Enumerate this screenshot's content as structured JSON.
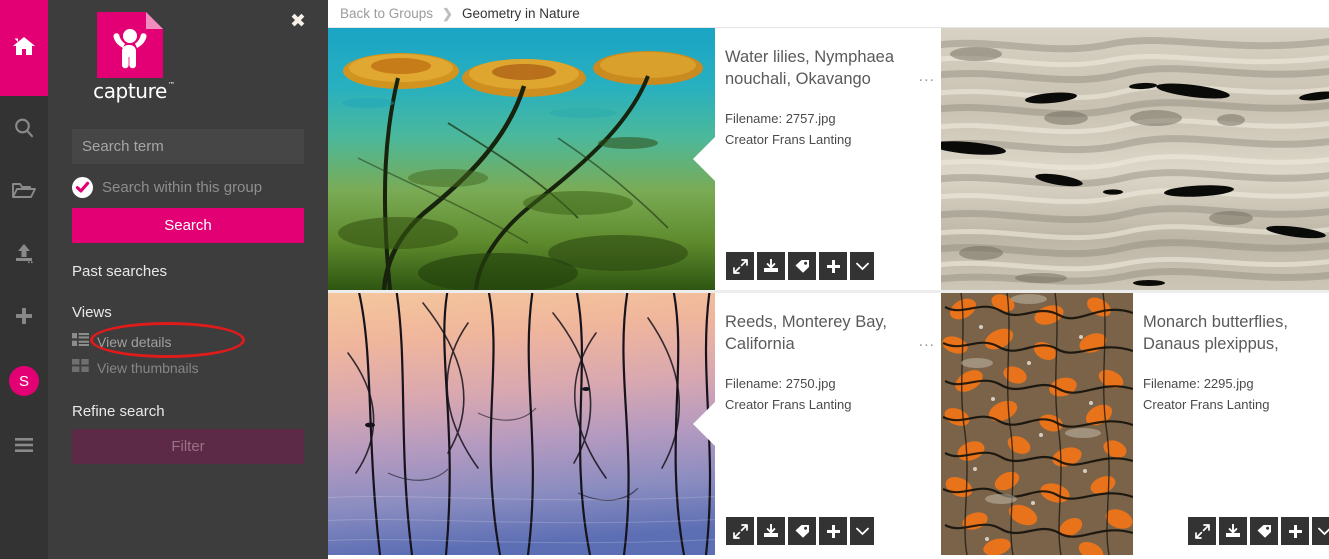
{
  "app": {
    "brand_name": "capture",
    "brand_tm": "™",
    "accent_color": "#e20074",
    "sidebar_color": "#3d3d3d",
    "rail_color": "#333333",
    "annotation_color": "#e01b1b"
  },
  "rail": {
    "items": [
      {
        "name": "home-icon",
        "label": "Home",
        "active": true
      },
      {
        "name": "search-icon",
        "label": "Search",
        "active": false
      },
      {
        "name": "folder-open-icon",
        "label": "Browse",
        "active": false
      },
      {
        "name": "upload-icon",
        "label": "Upload",
        "active": false
      },
      {
        "name": "plus-icon",
        "label": "Add",
        "active": false
      },
      {
        "name": "hamburger-icon",
        "label": "Menu",
        "active": false
      }
    ],
    "avatar_initial": "S"
  },
  "sidebar": {
    "close_label": "✖",
    "search": {
      "placeholder": "Search term",
      "value": "",
      "within_group_label": "Search within this group",
      "within_group_checked": true,
      "submit_label": "Search"
    },
    "past_searches_label": "Past searches",
    "views_label": "Views",
    "views": [
      {
        "label": "View details",
        "icon": "list-view-icon",
        "highlighted": true
      },
      {
        "label": "View thumbnails",
        "icon": "grid-view-icon",
        "highlighted": false
      }
    ],
    "refine_label": "Refine search",
    "filter_label": "Filter"
  },
  "breadcrumb": {
    "back_label": "Back to Groups",
    "separator": "❯",
    "current_label": "Geometry in Nature"
  },
  "results": {
    "filename_prefix": "Filename: ",
    "creator_prefix": "Creator ",
    "dots_label": "...",
    "actions": [
      {
        "name": "expand-icon",
        "label": "Preview"
      },
      {
        "name": "download-icon",
        "label": "Download"
      },
      {
        "name": "tag-icon",
        "label": "Tag"
      },
      {
        "name": "plus-icon",
        "label": "Add to"
      },
      {
        "name": "chevron-down-icon",
        "label": "More"
      }
    ],
    "items": [
      {
        "title": "Water lilies, Nymphaea nouchali, Okavango",
        "filename": "2757.jpg",
        "creator": "Frans Lanting",
        "thumb": "water-lilies-thumbnail"
      },
      {
        "title": "",
        "filename": "",
        "creator": "",
        "thumb": "water-ripples-thumbnail"
      },
      {
        "title": "Reeds, Monterey Bay, California",
        "filename": "2750.jpg",
        "creator": "Frans Lanting",
        "thumb": "reeds-thumbnail"
      },
      {
        "title": "Monarch butterflies, Danaus plexippus,",
        "filename": "2295.jpg",
        "creator": "Frans Lanting",
        "thumb": "monarch-butterflies-thumbnail"
      }
    ]
  }
}
